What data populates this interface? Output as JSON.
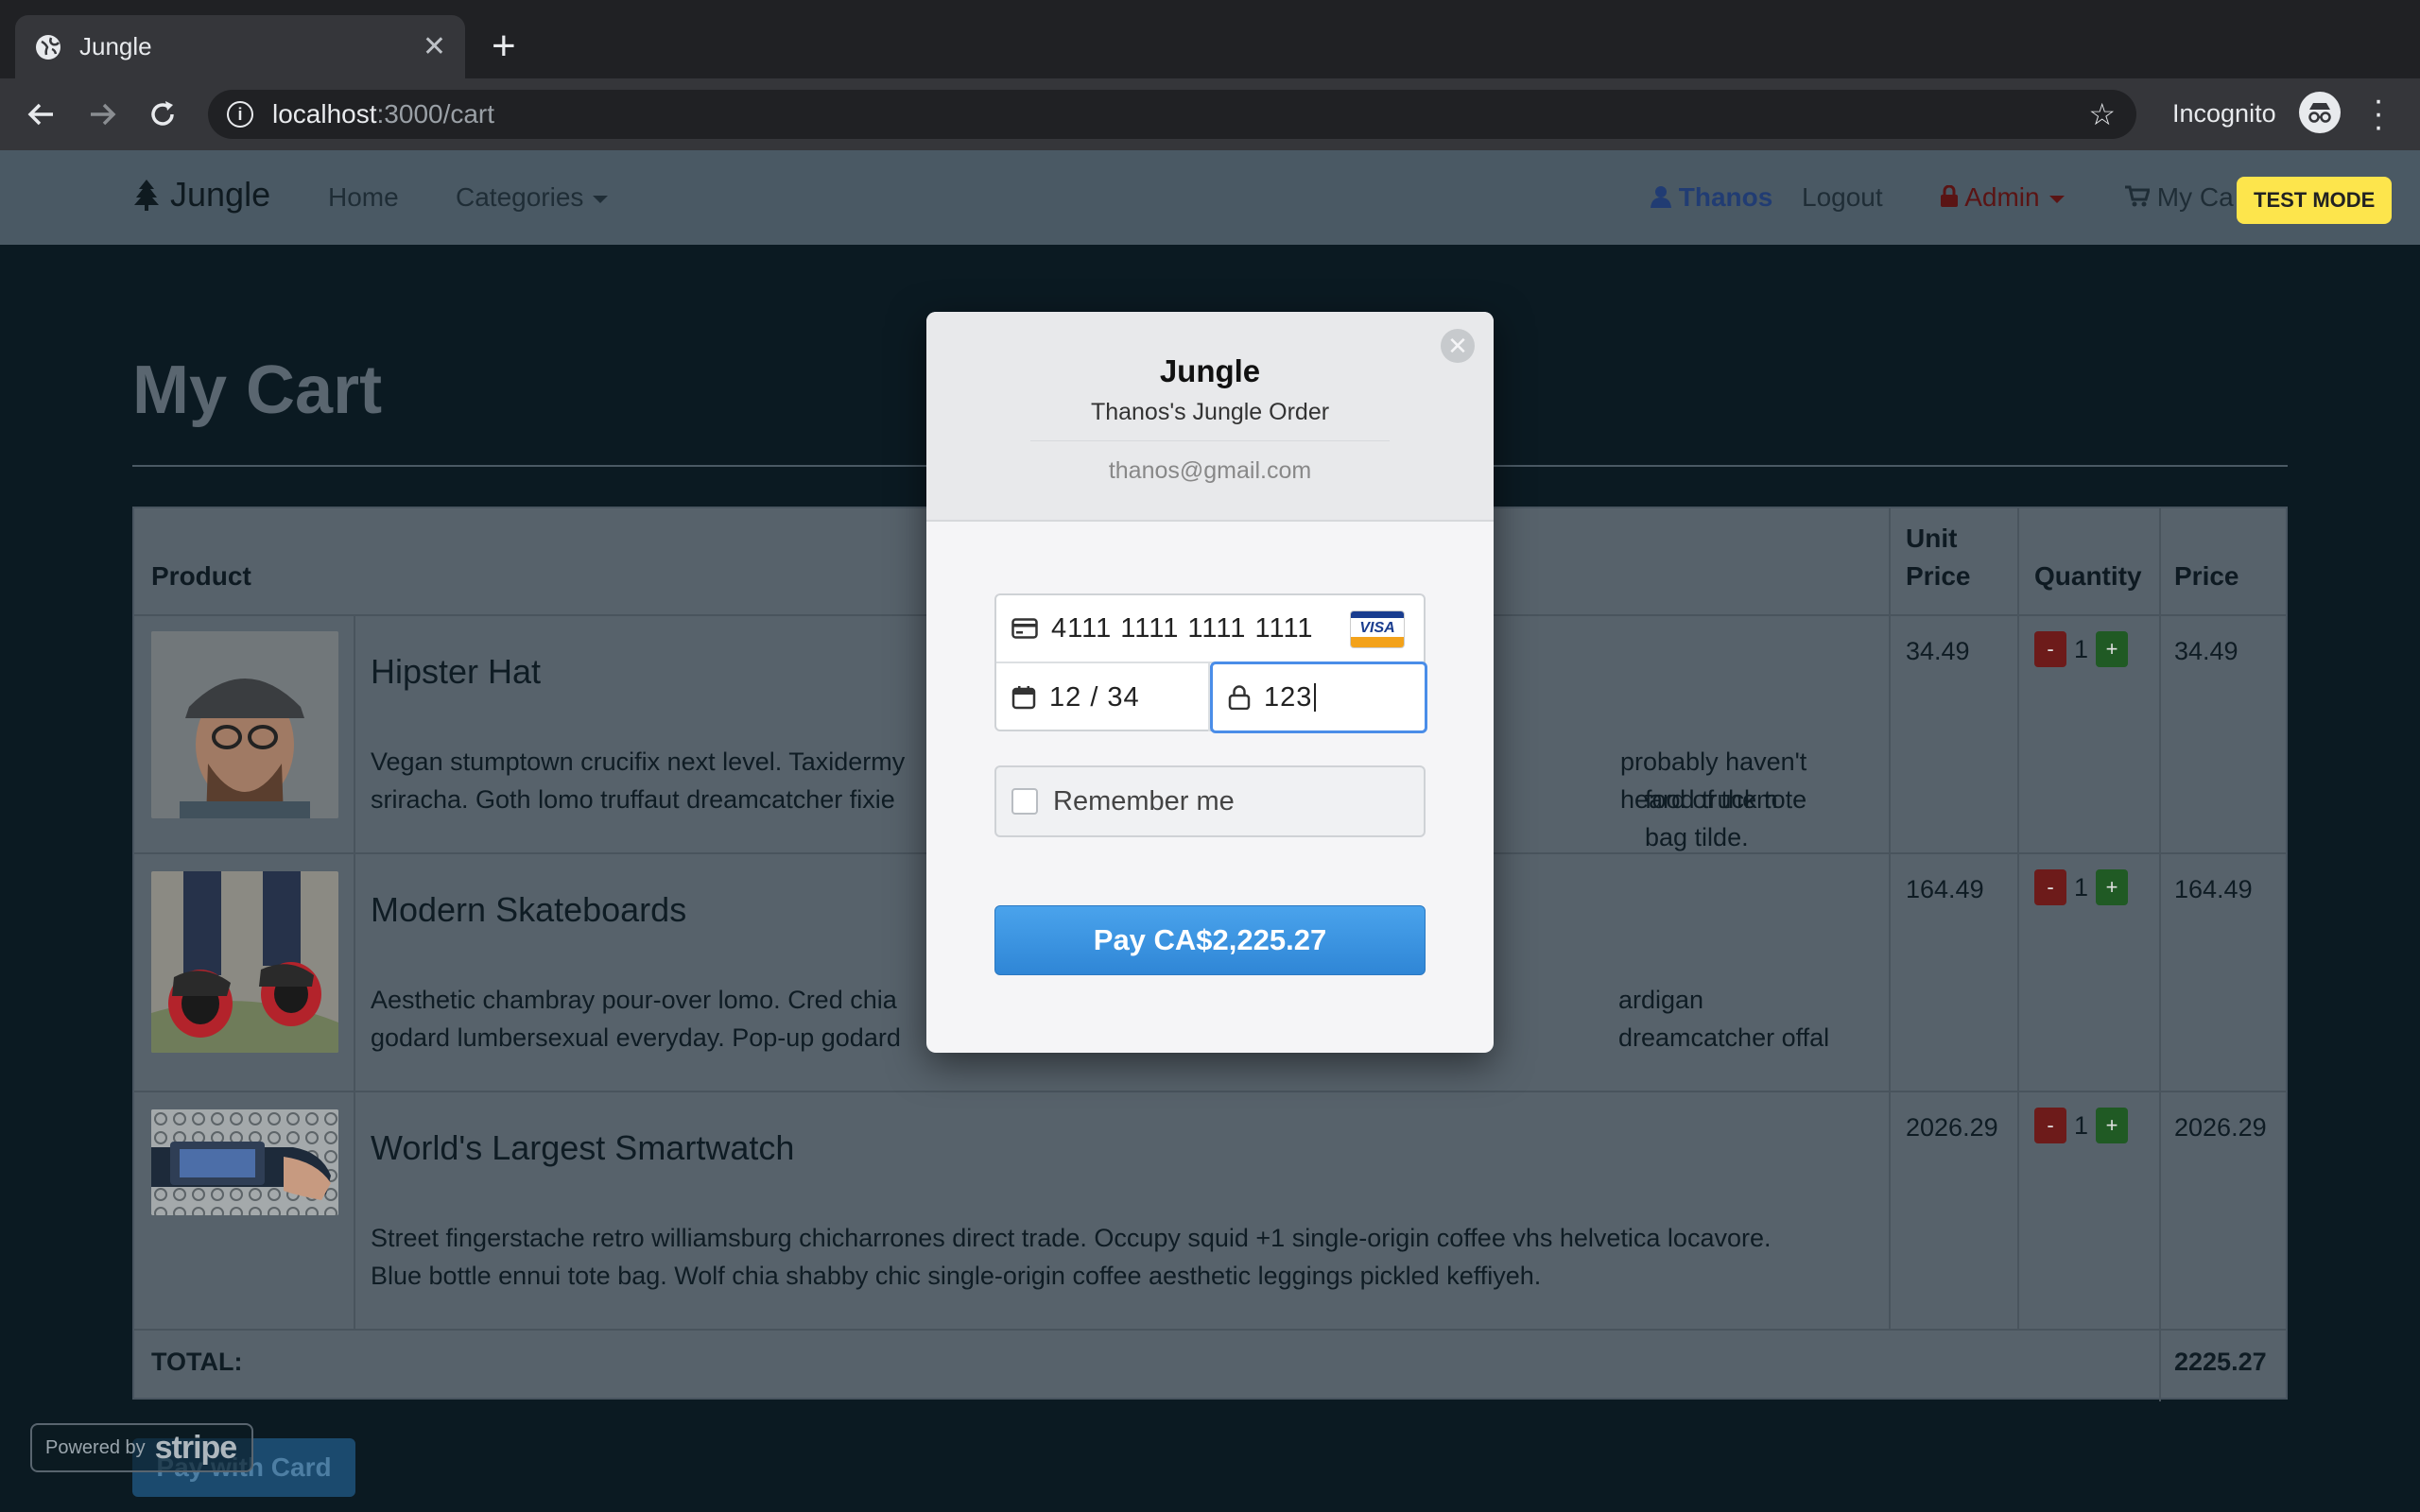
{
  "browser": {
    "tab_title": "Jungle",
    "url_host": "localhost",
    "url_path": ":3000/cart",
    "incognito_label": "Incognito"
  },
  "nav": {
    "brand": "Jungle",
    "home": "Home",
    "categories": "Categories",
    "user": "Thanos",
    "logout": "Logout",
    "admin": "Admin",
    "cart": "My Ca",
    "test_mode": "TEST MODE"
  },
  "page": {
    "title": "My Cart"
  },
  "table": {
    "headers": {
      "product": "Product",
      "unit_price_1": "Unit",
      "unit_price_2": "Price",
      "quantity": "Quantity",
      "price": "Price"
    },
    "rows": [
      {
        "name": "Hipster Hat",
        "description": "Vegan stumptown crucifix next level. Taxidermy [partially hidden] probably haven't heard of them sriracha. Goth lomo truffaut dreamcatcher fixie [partially hidden] food truck tote bag tilde.",
        "desc_left_1": "Vegan stumptown crucifix next level. Taxidermy",
        "desc_left_2": "sriracha. Goth lomo truffaut dreamcatcher fixie",
        "desc_right_1": "probably haven't heard of them",
        "desc_right_2": "food truck tote bag tilde.",
        "unit_price": "34.49",
        "quantity": "1",
        "price": "34.49"
      },
      {
        "name": "Modern Skateboards",
        "desc_left_1": "Aesthetic chambray pour-over lomo. Cred chia",
        "desc_left_2": "godard lumbersexual everyday. Pop-up godard",
        "desc_right_1": "ardigan dreamcatcher offal",
        "desc_right_2": "",
        "unit_price": "164.49",
        "quantity": "1",
        "price": "164.49"
      },
      {
        "name": "World's Largest Smartwatch",
        "desc_left_1": "Street fingerstache retro williamsburg chicharrones direct trade. Occupy squid +1 single-origin coffee vhs helvetica locavore.",
        "desc_left_2": "Blue bottle ennui tote bag. Wolf chia shabby chic single-origin coffee aesthetic leggings pickled keffiyeh.",
        "desc_right_1": "",
        "desc_right_2": "",
        "unit_price": "2026.29",
        "quantity": "1",
        "price": "2026.29"
      }
    ],
    "minus_label": "-",
    "plus_label": "+",
    "total_label": "TOTAL:",
    "total_value": "2225.27"
  },
  "pay_with_card": "Pay with Card",
  "stripe_badge": {
    "powered": "Powered by",
    "brand": "stripe"
  },
  "checkout": {
    "title": "Jungle",
    "subtitle": "Thanos's Jungle Order",
    "email": "thanos@gmail.com",
    "card_number": "4111 1111 1111 1111",
    "card_brand": "VISA",
    "expiry": "12 / 34",
    "cvc": "123",
    "remember_label": "Remember me",
    "pay_button": "Pay CA$2,225.27"
  }
}
